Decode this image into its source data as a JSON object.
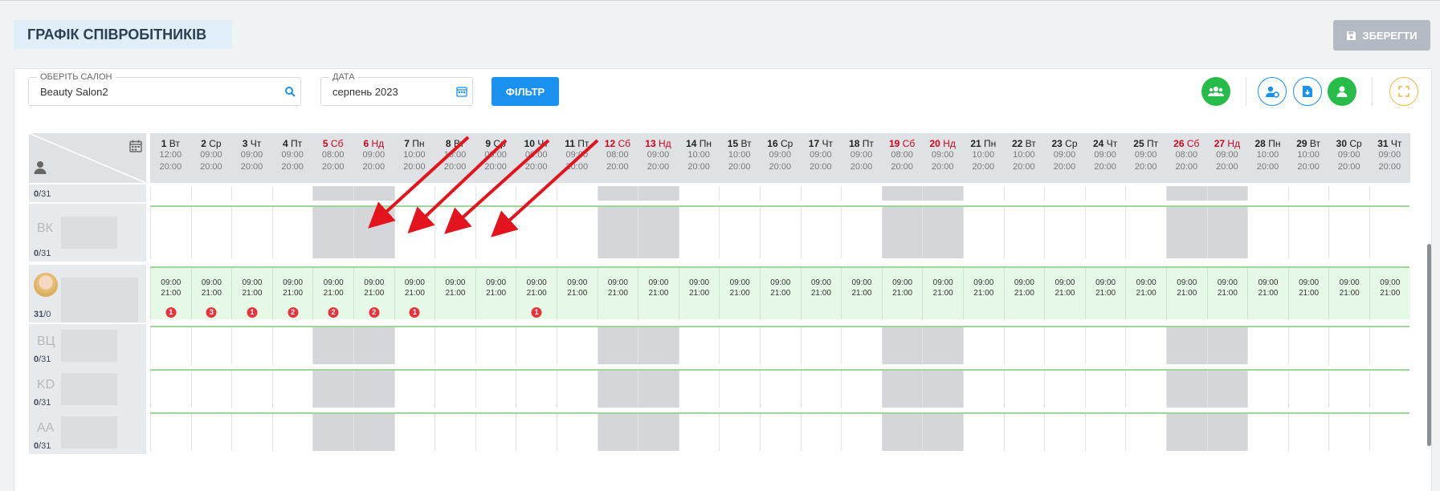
{
  "page_title": "ГРАФІК СПІВРОБІТНИКІВ",
  "save_label": "ЗБЕРЕГТИ",
  "salon": {
    "label": "ОБЕРІТЬ САЛОН",
    "value": "Beauty Salon2"
  },
  "date": {
    "label": "ДАТА",
    "value": "серпень 2023"
  },
  "filter_label": "ФІЛЬТР",
  "colors": {
    "accent": "#1a90f0",
    "green": "#27bc4a",
    "weekend_text": "#d0021b",
    "weekend_cell": "#d4d6d9",
    "active_row": "#e6f9e7",
    "badge": "#e8333f",
    "arrow": "#e3141d"
  },
  "days": [
    {
      "n": "1",
      "w": "Вт",
      "s": "12:00",
      "e": "20:00",
      "wk": false
    },
    {
      "n": "2",
      "w": "Ср",
      "s": "09:00",
      "e": "20:00",
      "wk": false
    },
    {
      "n": "3",
      "w": "Чт",
      "s": "09:00",
      "e": "20:00",
      "wk": false
    },
    {
      "n": "4",
      "w": "Пт",
      "s": "09:00",
      "e": "20:00",
      "wk": false
    },
    {
      "n": "5",
      "w": "Сб",
      "s": "08:00",
      "e": "20:00",
      "wk": true
    },
    {
      "n": "6",
      "w": "Нд",
      "s": "09:00",
      "e": "20:00",
      "wk": true
    },
    {
      "n": "7",
      "w": "Пн",
      "s": "10:00",
      "e": "20:00",
      "wk": false
    },
    {
      "n": "8",
      "w": "Вт",
      "s": "10:00",
      "e": "20:00",
      "wk": false
    },
    {
      "n": "9",
      "w": "Ср",
      "s": "09:00",
      "e": "20:00",
      "wk": false
    },
    {
      "n": "10",
      "w": "Чт",
      "s": "09:00",
      "e": "20:00",
      "wk": false
    },
    {
      "n": "11",
      "w": "Пт",
      "s": "09:00",
      "e": "20:00",
      "wk": false
    },
    {
      "n": "12",
      "w": "Сб",
      "s": "08:00",
      "e": "20:00",
      "wk": true
    },
    {
      "n": "13",
      "w": "Нд",
      "s": "09:00",
      "e": "20:00",
      "wk": true
    },
    {
      "n": "14",
      "w": "Пн",
      "s": "10:00",
      "e": "20:00",
      "wk": false
    },
    {
      "n": "15",
      "w": "Вт",
      "s": "10:00",
      "e": "20:00",
      "wk": false
    },
    {
      "n": "16",
      "w": "Ср",
      "s": "09:00",
      "e": "20:00",
      "wk": false
    },
    {
      "n": "17",
      "w": "Чт",
      "s": "09:00",
      "e": "20:00",
      "wk": false
    },
    {
      "n": "18",
      "w": "Пт",
      "s": "09:00",
      "e": "20:00",
      "wk": false
    },
    {
      "n": "19",
      "w": "Сб",
      "s": "08:00",
      "e": "20:00",
      "wk": true
    },
    {
      "n": "20",
      "w": "Нд",
      "s": "09:00",
      "e": "20:00",
      "wk": true
    },
    {
      "n": "21",
      "w": "Пн",
      "s": "10:00",
      "e": "20:00",
      "wk": false
    },
    {
      "n": "22",
      "w": "Вт",
      "s": "10:00",
      "e": "20:00",
      "wk": false
    },
    {
      "n": "23",
      "w": "Ср",
      "s": "09:00",
      "e": "20:00",
      "wk": false
    },
    {
      "n": "24",
      "w": "Чт",
      "s": "09:00",
      "e": "20:00",
      "wk": false
    },
    {
      "n": "25",
      "w": "Пт",
      "s": "09:00",
      "e": "20:00",
      "wk": false
    },
    {
      "n": "26",
      "w": "Сб",
      "s": "08:00",
      "e": "20:00",
      "wk": true
    },
    {
      "n": "27",
      "w": "Нд",
      "s": "09:00",
      "e": "20:00",
      "wk": true
    },
    {
      "n": "28",
      "w": "Пн",
      "s": "10:00",
      "e": "20:00",
      "wk": false
    },
    {
      "n": "29",
      "w": "Вт",
      "s": "10:00",
      "e": "20:00",
      "wk": false
    },
    {
      "n": "30",
      "w": "Ср",
      "s": "09:00",
      "e": "20:00",
      "wk": false
    },
    {
      "n": "31",
      "w": "Чт",
      "s": "09:00",
      "e": "20:00",
      "wk": false
    }
  ],
  "employees": [
    {
      "initials": "",
      "count": "0",
      "total": "/31",
      "active": false
    },
    {
      "initials": "ВК",
      "count": "0",
      "total": "/31",
      "active": false
    },
    {
      "initials": "",
      "count": "31",
      "total": "/0",
      "active": true,
      "start": "09:00",
      "end": "21:00",
      "badges": [
        "1",
        "3",
        "1",
        "2",
        "2",
        "2",
        "1",
        "",
        "",
        "1",
        "",
        "",
        "",
        "",
        "",
        "",
        "",
        "",
        "",
        "",
        "",
        "",
        "",
        "",
        "",
        "",
        "",
        "",
        "",
        "",
        ""
      ]
    },
    {
      "initials": "ВЦ",
      "count": "0",
      "total": "/31",
      "active": false
    },
    {
      "initials": "KD",
      "count": "0",
      "total": "/31",
      "active": false
    },
    {
      "initials": "AA",
      "count": "0",
      "total": "/31",
      "active": false
    }
  ]
}
